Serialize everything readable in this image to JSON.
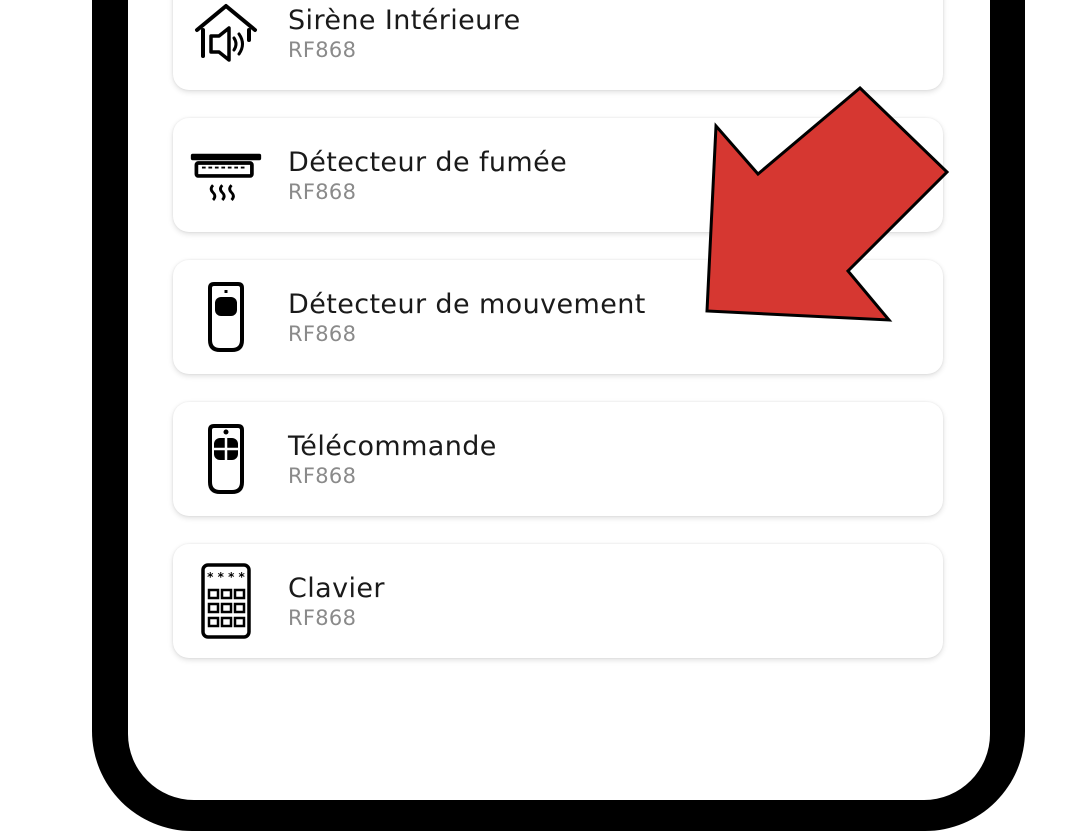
{
  "devices": [
    {
      "name": "Sirène Intérieure",
      "protocol": "RF868",
      "icon": "siren-icon"
    },
    {
      "name": "Détecteur de fumée",
      "protocol": "RF868",
      "icon": "smoke-detector-icon"
    },
    {
      "name": "Détecteur de mouvement",
      "protocol": "RF868",
      "icon": "motion-detector-icon"
    },
    {
      "name": "Télécommande",
      "protocol": "RF868",
      "icon": "remote-control-icon"
    },
    {
      "name": "Clavier",
      "protocol": "RF868",
      "icon": "keypad-icon"
    }
  ],
  "annotation": {
    "arrow_color": "#d63731",
    "arrow_target": "Détecteur de mouvement"
  },
  "colors": {
    "frame": "#000000",
    "name_text": "#1a1a1a",
    "protocol_text": "#8a8a8a"
  }
}
